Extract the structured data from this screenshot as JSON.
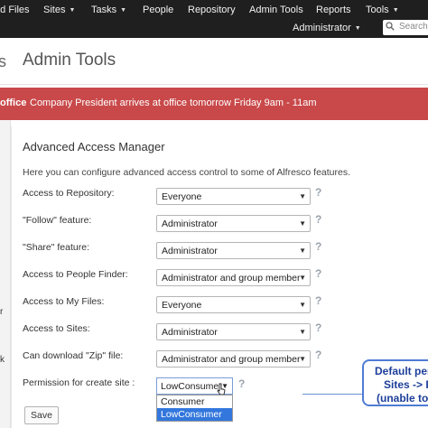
{
  "nav": {
    "items": [
      {
        "label": "Files",
        "prefix": "ed",
        "dropdown": false
      },
      {
        "label": "Sites",
        "dropdown": true
      },
      {
        "label": "Tasks",
        "dropdown": true
      },
      {
        "label": "People",
        "dropdown": false
      },
      {
        "label": "Repository",
        "dropdown": false
      },
      {
        "label": "Admin Tools",
        "dropdown": false
      },
      {
        "label": "Reports",
        "dropdown": false
      },
      {
        "label": "Tools",
        "dropdown": true
      }
    ],
    "user": "Administrator",
    "search_placeholder": "Search"
  },
  "title": {
    "stub": "s",
    "text": "Admin Tools"
  },
  "banner": {
    "label": "office",
    "message": "Company President arrives at office tomorrow Friday 9am - 11am"
  },
  "sidebar": {
    "fragments": [
      "r",
      "k"
    ]
  },
  "manager": {
    "title": "Advanced Access Manager",
    "intro": "Here you can configure advanced access control to some of Alfresco features.",
    "rows": [
      {
        "label": "Access to Repository:",
        "value": "Everyone"
      },
      {
        "label": "\"Follow\" feature:",
        "value": "Administrator"
      },
      {
        "label": "\"Share\" feature:",
        "value": "Administrator"
      },
      {
        "label": "Access to People Finder:",
        "value": "Administrator and group member"
      },
      {
        "label": "Access to My Files:",
        "value": "Everyone"
      },
      {
        "label": "Access to Sites:",
        "value": "Administrator"
      },
      {
        "label": "Can download \"Zip\" file:",
        "value": "Administrator and group member"
      }
    ],
    "help_symbol": "?",
    "create_site": {
      "label": "Permission for create site :",
      "value": "LowConsumer",
      "options": [
        "Consumer",
        "LowConsumer"
      ],
      "selected_option": "LowConsumer"
    },
    "save_label": "Save"
  },
  "callout": {
    "lines": [
      "Default per",
      "Sites -> R",
      "(unable to"
    ]
  },
  "colors": {
    "nav_bg": "#1f1f1f",
    "banner_bg": "#c9494a",
    "callout_border": "#4f7cd4",
    "option_highlight": "#3377dd"
  }
}
